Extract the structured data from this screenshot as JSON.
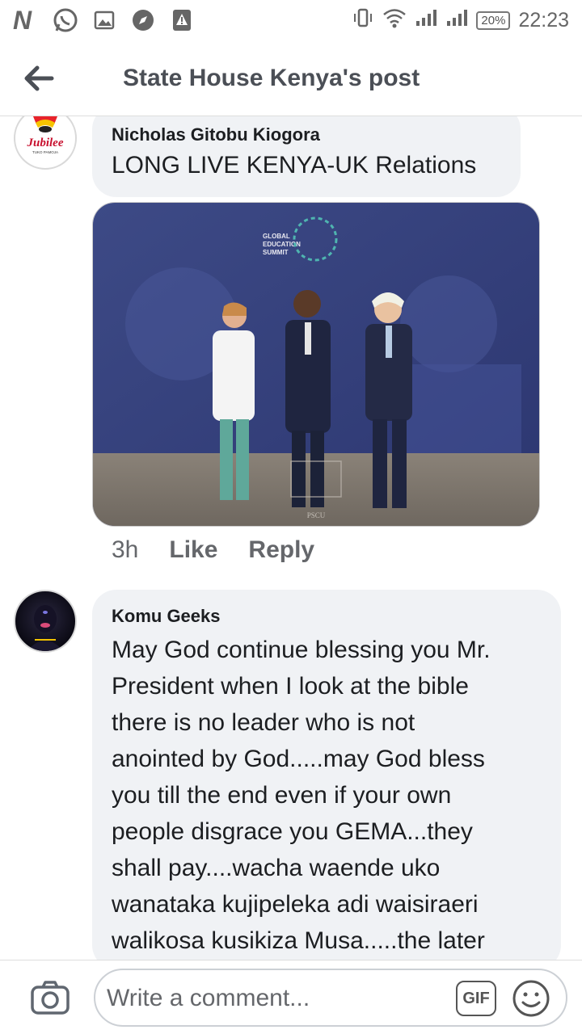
{
  "status_bar": {
    "left_icons": [
      "netflix-n-icon",
      "whatsapp-icon",
      "gallery-icon",
      "compass-icon",
      "alert-icon"
    ],
    "n_glyph": "N",
    "battery": "20%",
    "time": "22:23"
  },
  "header": {
    "title": "State House Kenya's post"
  },
  "comments": [
    {
      "author": "Nicholas Gitobu Kiogora",
      "text": "LONG LIVE KENYA-UK Relations",
      "avatar_text": "Jubilee",
      "avatar_subtext": "TUKO PAMOJA",
      "photo": {
        "banner_text": [
          "GLOBAL",
          "EDUCATION",
          "SUMMIT"
        ],
        "watermark": "PSCU"
      },
      "time": "3h",
      "like_label": "Like",
      "reply_label": "Reply"
    },
    {
      "author": "Komu Geeks",
      "lines": [
        "May God continue blessing you Mr.",
        "President when I look at the bible",
        "there is no leader who is not",
        "anointed by God.....may God bless",
        "you till the end even if your own",
        "people disgrace you GEMA...they",
        "shall pay....wacha waende uko",
        "wanataka kujipeleka adi waisiraeri",
        "walikosa kusikiza Musa.....the later"
      ]
    }
  ],
  "composer": {
    "placeholder": "Write a comment...",
    "gif_label": "GIF"
  }
}
